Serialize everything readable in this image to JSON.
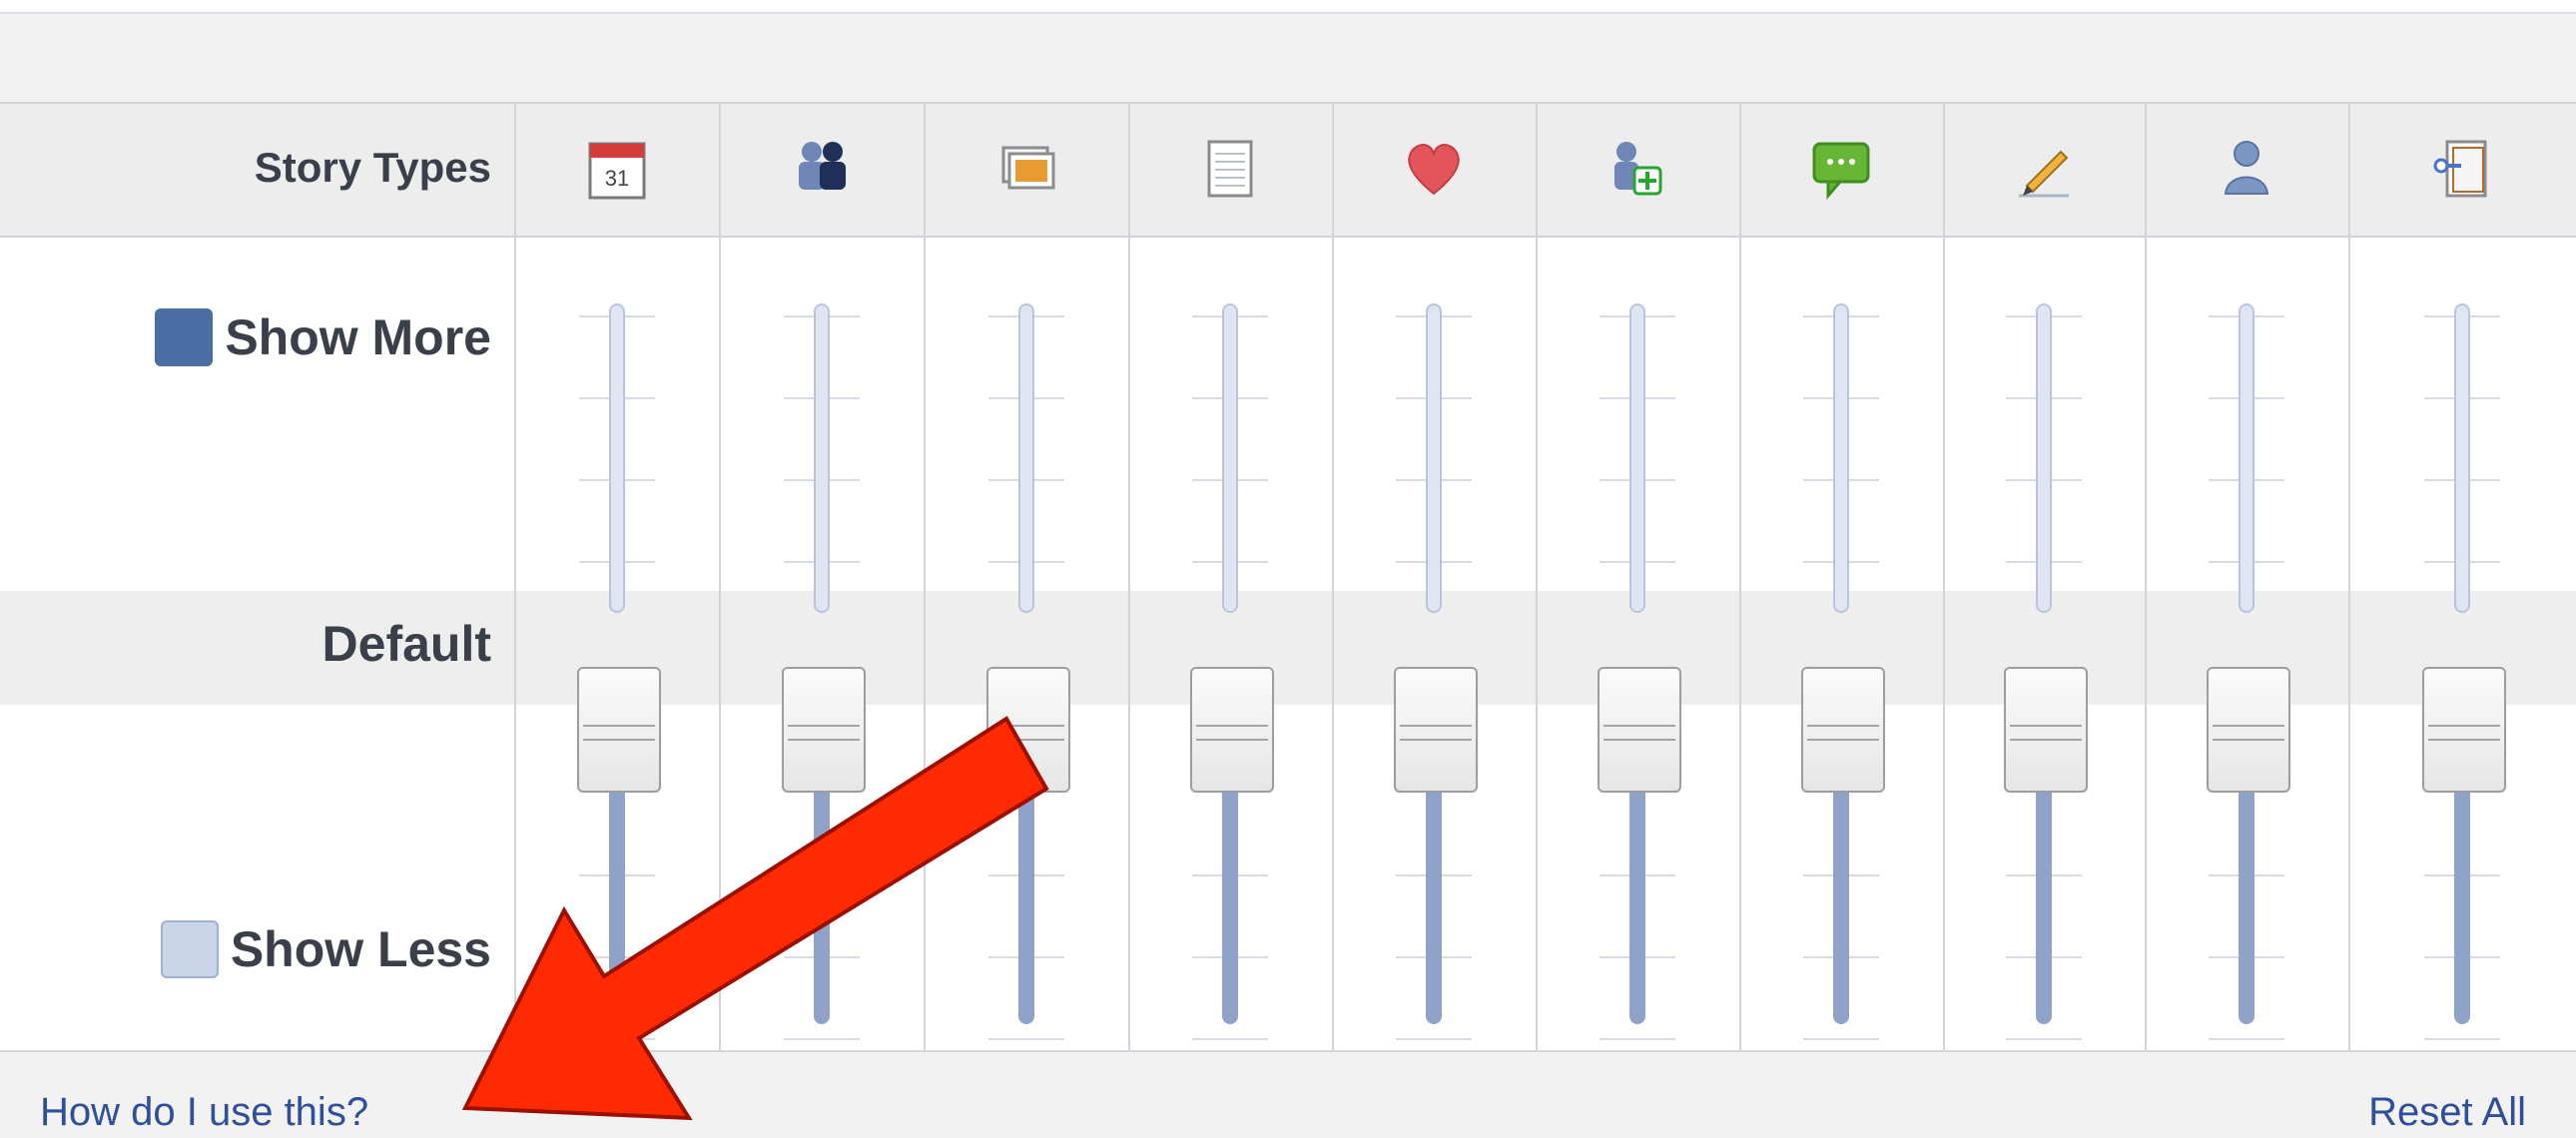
{
  "labels": {
    "story_types": "Story Types",
    "show_more": "Show More",
    "default": "Default",
    "show_less": "Show Less"
  },
  "columns": [
    {
      "icon": "calendar-icon",
      "value": "Default"
    },
    {
      "icon": "friends-icon",
      "value": "Default"
    },
    {
      "icon": "photos-icon",
      "value": "Default"
    },
    {
      "icon": "notes-icon",
      "value": "Default"
    },
    {
      "icon": "heart-icon",
      "value": "Default"
    },
    {
      "icon": "add-friend-icon",
      "value": "Default"
    },
    {
      "icon": "comments-icon",
      "value": "Default"
    },
    {
      "icon": "edit-icon",
      "value": "Default"
    },
    {
      "icon": "profile-icon",
      "value": "Default"
    },
    {
      "icon": "page-icon",
      "value": "Default"
    }
  ],
  "calendar_day": "31",
  "links": {
    "how": "How do I use this?",
    "reset": "Reset All"
  },
  "colors": {
    "accent_link": "#2f4f9a",
    "annotation_arrow": "#ff2a00"
  }
}
